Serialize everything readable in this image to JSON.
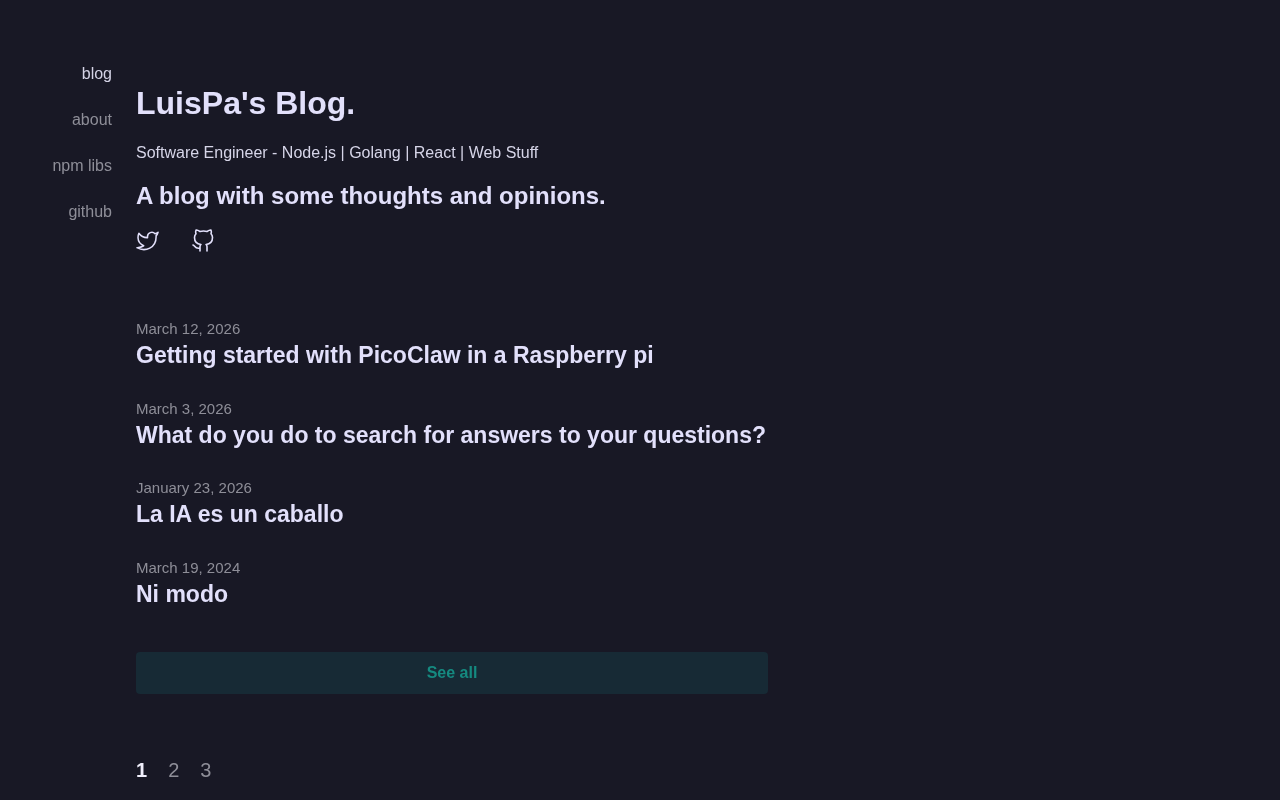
{
  "nav": {
    "items": [
      {
        "label": "blog",
        "selected": true
      },
      {
        "label": "about",
        "selected": false
      },
      {
        "label": "npm libs",
        "selected": false
      },
      {
        "label": "github",
        "selected": false
      }
    ]
  },
  "header": {
    "title": "LuisPa's Blog.",
    "subtitle": "Software Engineer - Node.js | Golang | React | Web Stuff",
    "tagline": "A blog with some thoughts and opinions."
  },
  "posts": [
    {
      "date": "March 12, 2026",
      "title": "Getting started with PicoClaw in a Raspberry pi"
    },
    {
      "date": "March 3, 2026",
      "title": "What do you do to search for answers to your questions?"
    },
    {
      "date": "January 23, 2026",
      "title": "La IA es un caballo"
    },
    {
      "date": "March 19, 2024",
      "title": "Ni modo"
    }
  ],
  "see_all_button": {
    "label": "See all"
  },
  "pagination": [
    {
      "label": "1",
      "selected": true
    },
    {
      "label": "2",
      "selected": false
    },
    {
      "label": "3",
      "selected": false
    }
  ]
}
